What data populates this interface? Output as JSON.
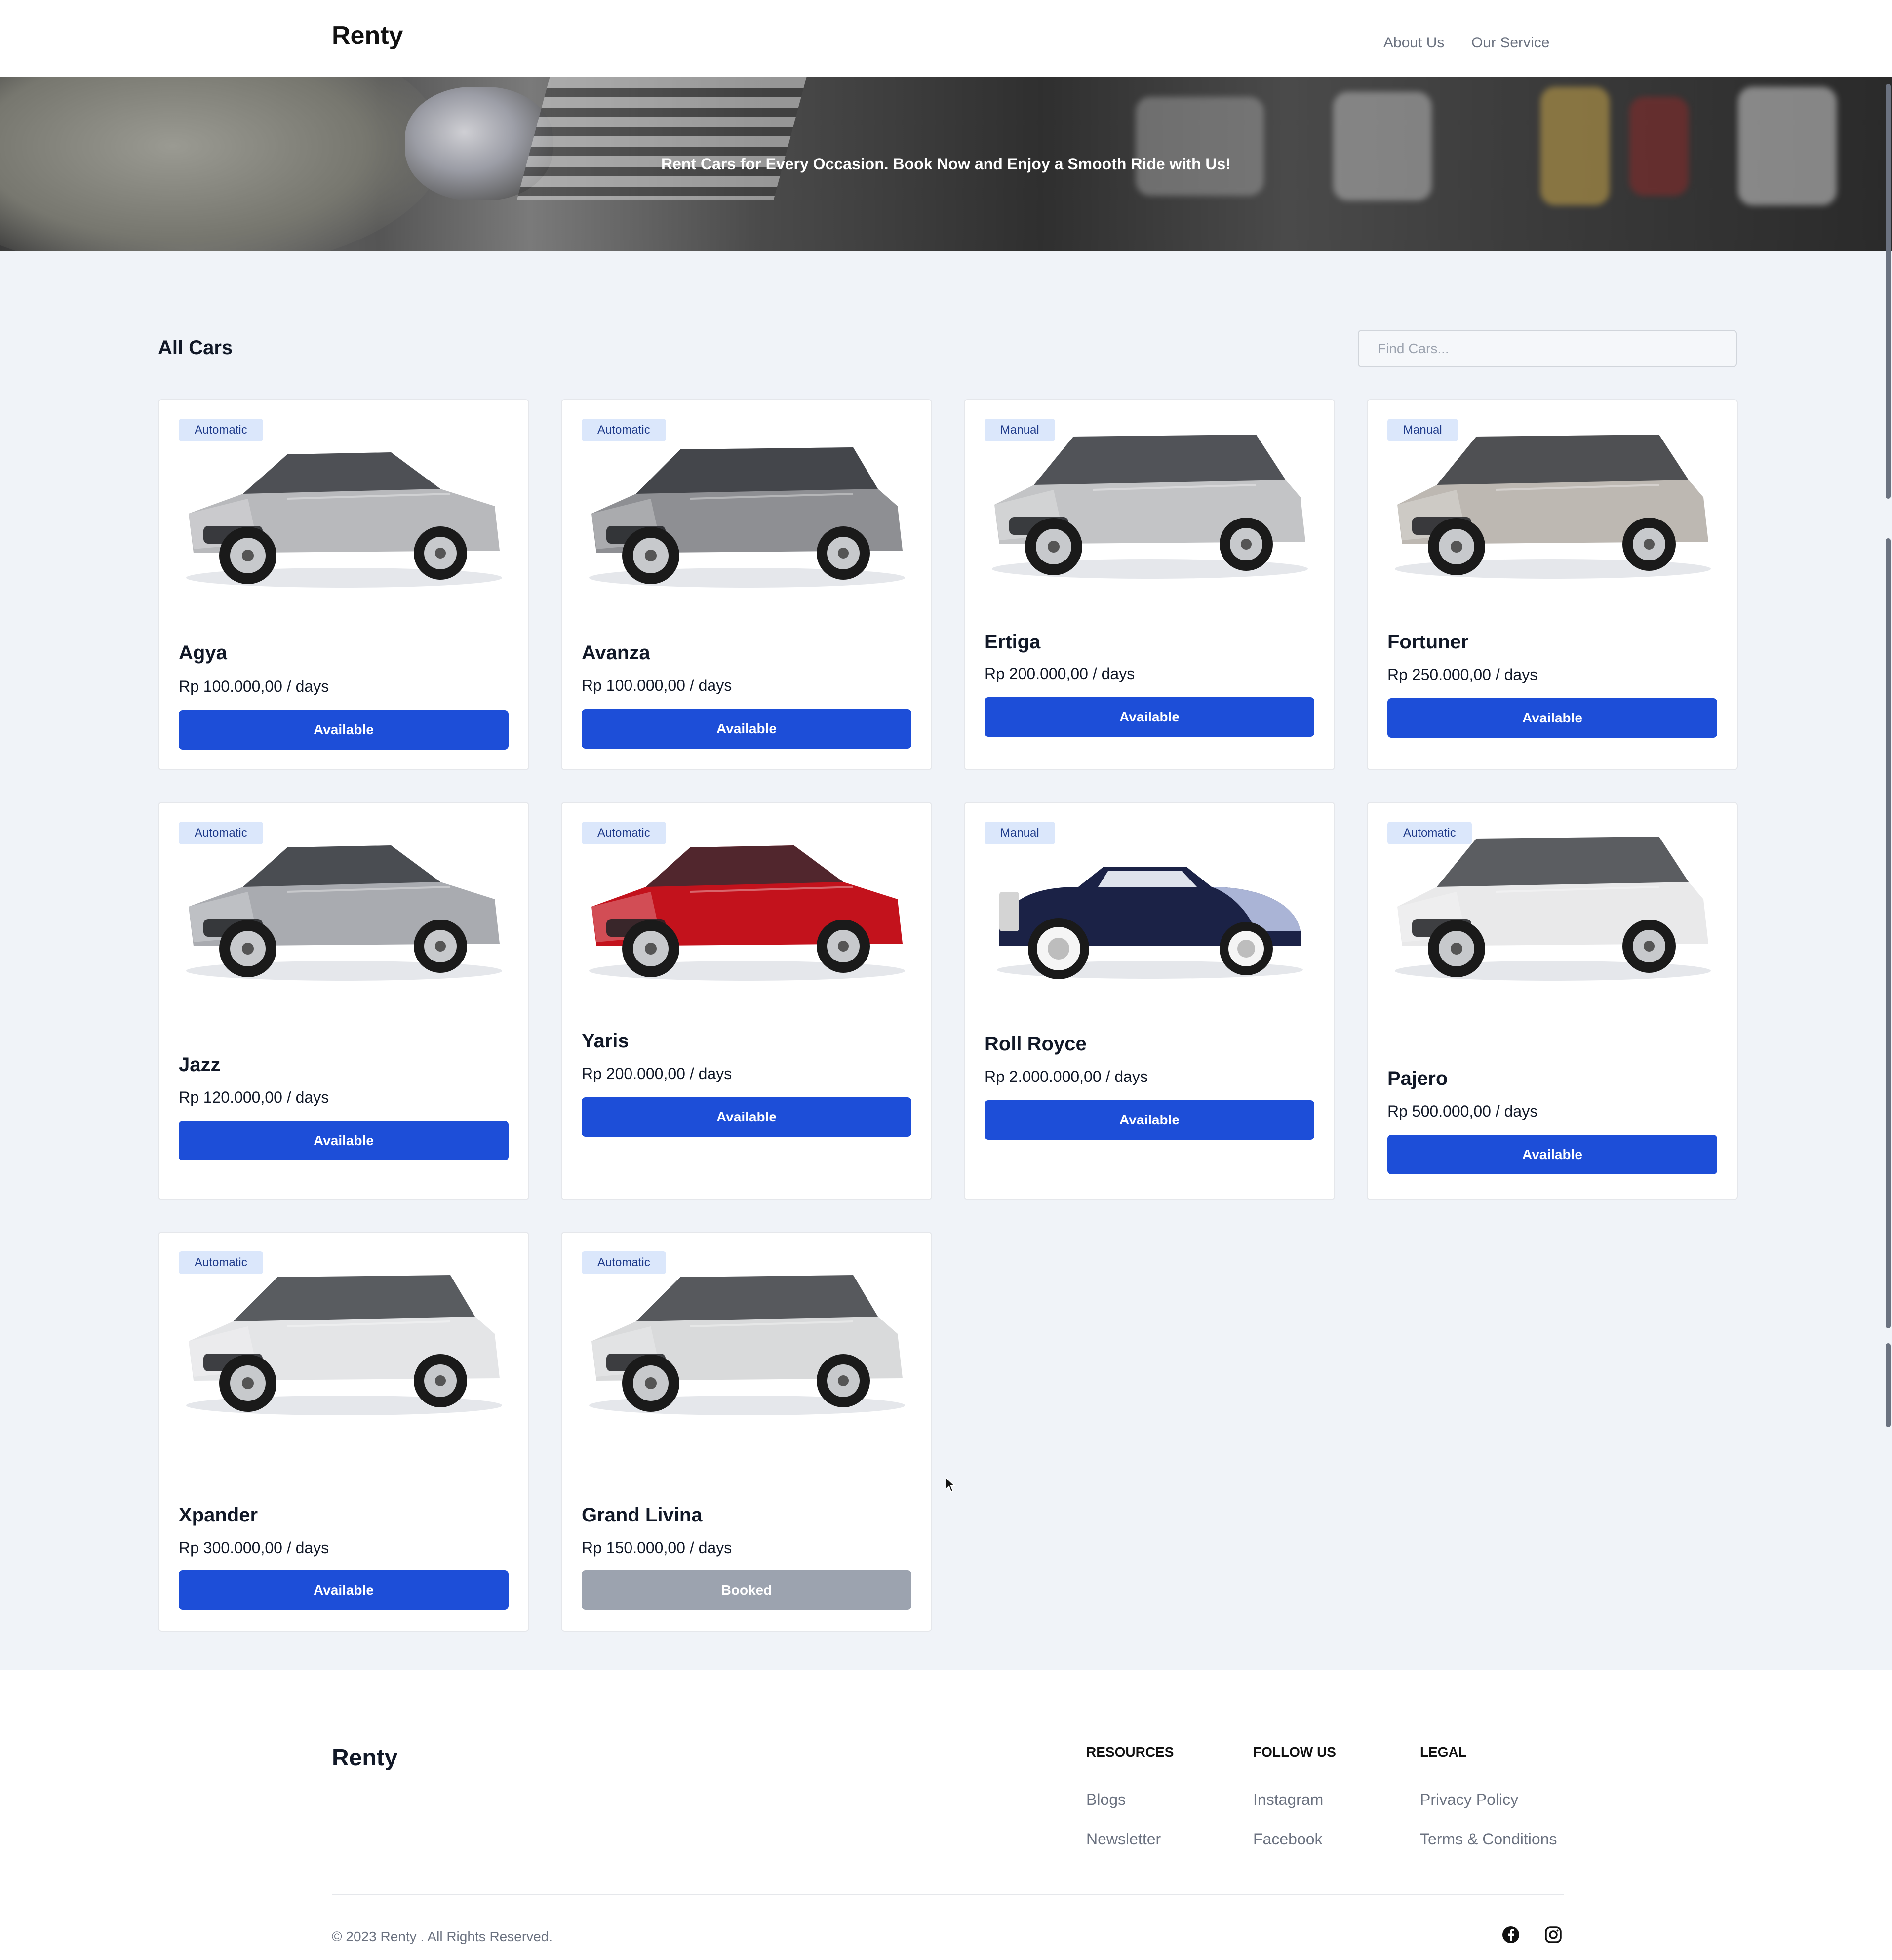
{
  "header": {
    "brand": "Renty",
    "nav": [
      "About Us",
      "Our Service"
    ]
  },
  "hero": {
    "tagline": "Rent Cars for Every Occasion. Book Now and Enjoy a Smooth Ride with Us!"
  },
  "catalog": {
    "title": "All Cars",
    "search_placeholder": "Find Cars...",
    "cars": [
      {
        "transmission": "Automatic",
        "name": "Agya",
        "price": "Rp 100.000,00 / days",
        "status": "Available",
        "body_color": "#b8b9bc",
        "style": "hatch"
      },
      {
        "transmission": "Automatic",
        "name": "Avanza",
        "price": "Rp 100.000,00 / days",
        "status": "Available",
        "body_color": "#8e8f93",
        "style": "mpv"
      },
      {
        "transmission": "Manual",
        "name": "Ertiga",
        "price": "Rp 200.000,00 / days",
        "status": "Available",
        "body_color": "#c3c4c6",
        "style": "suv"
      },
      {
        "transmission": "Manual",
        "name": "Fortuner",
        "price": "Rp 250.000,00 / days",
        "status": "Available",
        "body_color": "#bdb8b2",
        "style": "suv"
      },
      {
        "transmission": "Automatic",
        "name": "Jazz",
        "price": "Rp 120.000,00 / days",
        "status": "Available",
        "body_color": "#a9abb0",
        "style": "hatch"
      },
      {
        "transmission": "Automatic",
        "name": "Yaris",
        "price": "Rp 200.000,00 / days",
        "status": "Available",
        "body_color": "#c3121c",
        "style": "hatch"
      },
      {
        "transmission": "Manual",
        "name": "Roll Royce",
        "price": "Rp 2.000.000,00 / days",
        "status": "Available",
        "body_color": "#1b2246",
        "style": "classic"
      },
      {
        "transmission": "Automatic",
        "name": "Pajero",
        "price": "Rp 500.000,00 / days",
        "status": "Available",
        "body_color": "#e9e9ea",
        "style": "suv"
      },
      {
        "transmission": "Automatic",
        "name": "Xpander",
        "price": "Rp 300.000,00 / days",
        "status": "Available",
        "body_color": "#e4e5e7",
        "style": "mpv"
      },
      {
        "transmission": "Automatic",
        "name": "Grand Livina",
        "price": "Rp 150.000,00 / days",
        "status": "Booked",
        "body_color": "#d9dadb",
        "style": "mpv"
      }
    ]
  },
  "footer": {
    "brand": "Renty",
    "columns": [
      {
        "title": "RESOURCES",
        "links": [
          "Blogs",
          "Newsletter"
        ]
      },
      {
        "title": "FOLLOW US",
        "links": [
          "Instagram",
          "Facebook"
        ]
      },
      {
        "title": "LEGAL",
        "links": [
          "Privacy Policy",
          "Terms & Conditions"
        ]
      }
    ],
    "copyright": "© 2023 Renty . All Rights Reserved.",
    "social_icons": [
      "facebook-icon",
      "instagram-icon"
    ]
  },
  "colors": {
    "primary": "#1d4ed8",
    "booked": "#9ca3af",
    "page_bg": "#f0f3f8",
    "badge_bg": "#dbe7fb"
  }
}
